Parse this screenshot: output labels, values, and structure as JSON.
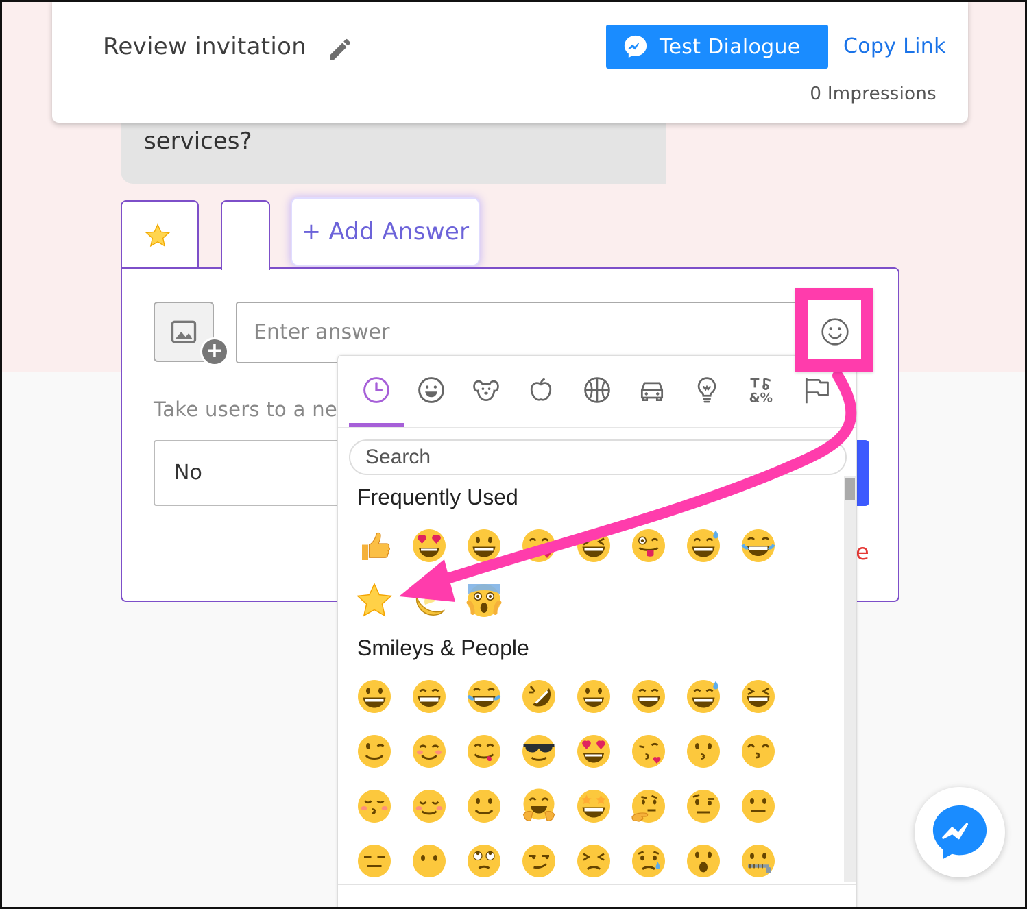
{
  "header": {
    "title": "Review invitation",
    "test_button_label": "Test Dialogue",
    "copy_link_label": "Copy Link",
    "impressions": "0 Impressions"
  },
  "question": {
    "text": "services?"
  },
  "tabs": {
    "add_answer_label": "+ Add Answer"
  },
  "answer": {
    "input_placeholder": "Enter answer",
    "take_users_text": "Take users to a new",
    "next_step_value": "No",
    "trailing_red_text": "e"
  },
  "emoji_picker": {
    "categories": [
      "clock-icon",
      "smiley-icon",
      "dog-icon",
      "apple-icon",
      "basketball-icon",
      "car-icon",
      "lightbulb-icon",
      "symbols-icon",
      "flag-icon"
    ],
    "active_category": "clock-icon",
    "search_placeholder": "Search",
    "sections": [
      {
        "title": "Frequently Used"
      },
      {
        "title": "Smileys & People"
      }
    ]
  },
  "colors": {
    "accent_purple": "#7d4fc9",
    "messenger_blue": "#1a8cff",
    "highlight_pink": "#ff3cac"
  }
}
